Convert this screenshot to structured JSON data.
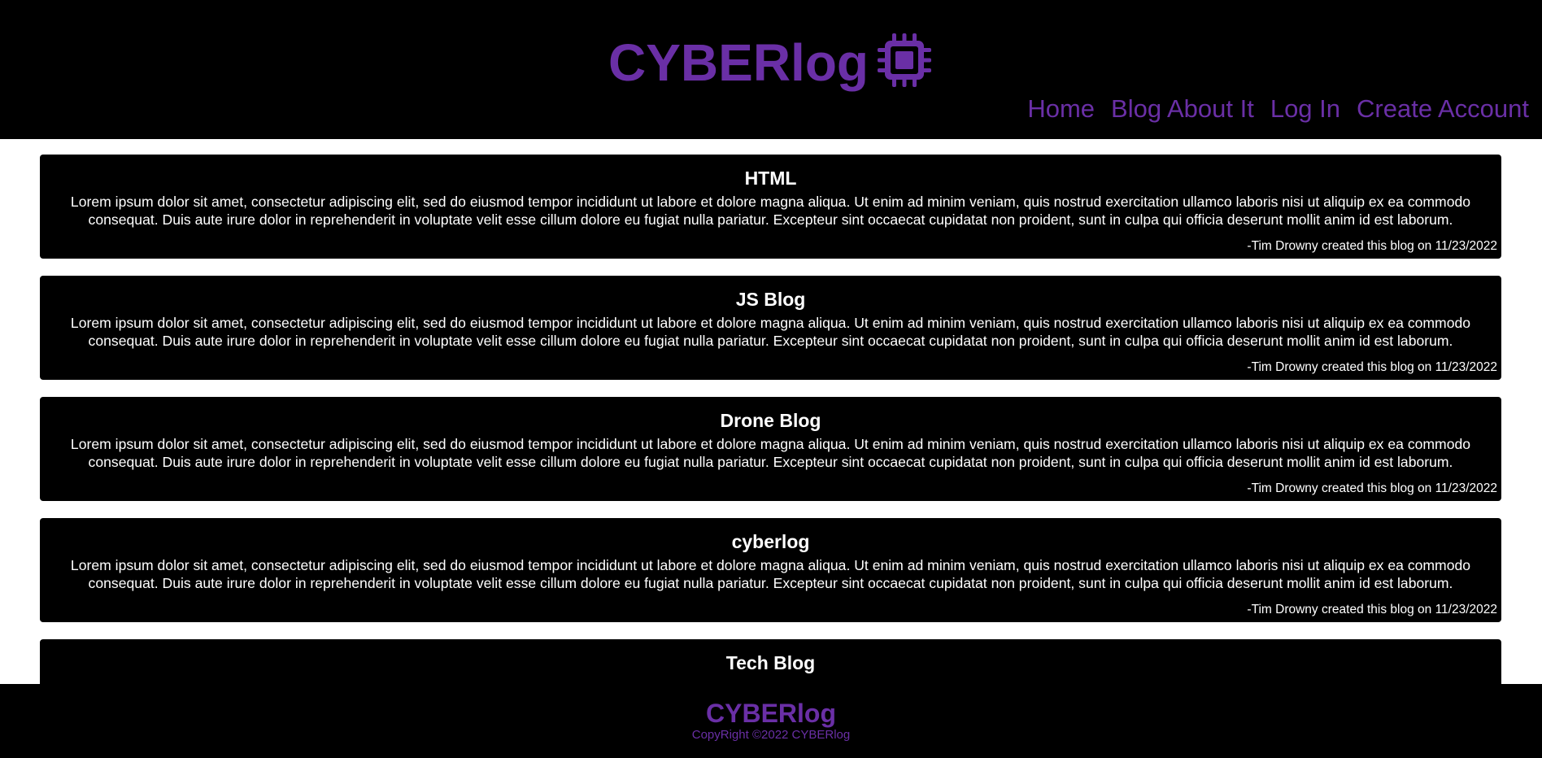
{
  "site": {
    "title": "CYBERlog",
    "logo_icon": "chip-icon",
    "accent_color": "#6a2fa6"
  },
  "nav": {
    "items": [
      {
        "label": "Home"
      },
      {
        "label": "Blog About It"
      },
      {
        "label": "Log In"
      },
      {
        "label": "Create Account"
      }
    ]
  },
  "posts": [
    {
      "title": "HTML",
      "body_line1": "Lorem ipsum dolor sit amet, consectetur adipiscing elit, sed do eiusmod tempor incididunt ut labore et dolore magna aliqua. Ut enim ad minim veniam, quis nostrud exercitation ullamco laboris nisi ut aliquip ex ea commodo",
      "body_line2": "consequat. Duis aute irure dolor in reprehenderit in voluptate velit esse cillum dolore eu fugiat nulla pariatur. Excepteur sint occaecat cupidatat non proident, sunt in culpa qui officia deserunt mollit anim id est laborum.",
      "meta": "-Tim Drowny created this blog on 11/23/2022"
    },
    {
      "title": "JS Blog",
      "body_line1": "Lorem ipsum dolor sit amet, consectetur adipiscing elit, sed do eiusmod tempor incididunt ut labore et dolore magna aliqua. Ut enim ad minim veniam, quis nostrud exercitation ullamco laboris nisi ut aliquip ex ea commodo",
      "body_line2": "consequat. Duis aute irure dolor in reprehenderit in voluptate velit esse cillum dolore eu fugiat nulla pariatur. Excepteur sint occaecat cupidatat non proident, sunt in culpa qui officia deserunt mollit anim id est laborum.",
      "meta": "-Tim Drowny created this blog on 11/23/2022"
    },
    {
      "title": "Drone Blog",
      "body_line1": "Lorem ipsum dolor sit amet, consectetur adipiscing elit, sed do eiusmod tempor incididunt ut labore et dolore magna aliqua. Ut enim ad minim veniam, quis nostrud exercitation ullamco laboris nisi ut aliquip ex ea commodo",
      "body_line2": "consequat. Duis aute irure dolor in reprehenderit in voluptate velit esse cillum dolore eu fugiat nulla pariatur. Excepteur sint occaecat cupidatat non proident, sunt in culpa qui officia deserunt mollit anim id est laborum.",
      "meta": "-Tim Drowny created this blog on 11/23/2022"
    },
    {
      "title": "cyberlog",
      "body_line1": "Lorem ipsum dolor sit amet, consectetur adipiscing elit, sed do eiusmod tempor incididunt ut labore et dolore magna aliqua. Ut enim ad minim veniam, quis nostrud exercitation ullamco laboris nisi ut aliquip ex ea commodo",
      "body_line2": "consequat. Duis aute irure dolor in reprehenderit in voluptate velit esse cillum dolore eu fugiat nulla pariatur. Excepteur sint occaecat cupidatat non proident, sunt in culpa qui officia deserunt mollit anim id est laborum.",
      "meta": "-Tim Drowny created this blog on 11/23/2022"
    },
    {
      "title": "Tech Blog"
    }
  ],
  "footer": {
    "brand": "CYBERlog",
    "copyright": "CopyRight ©2022 CYBERlog"
  }
}
